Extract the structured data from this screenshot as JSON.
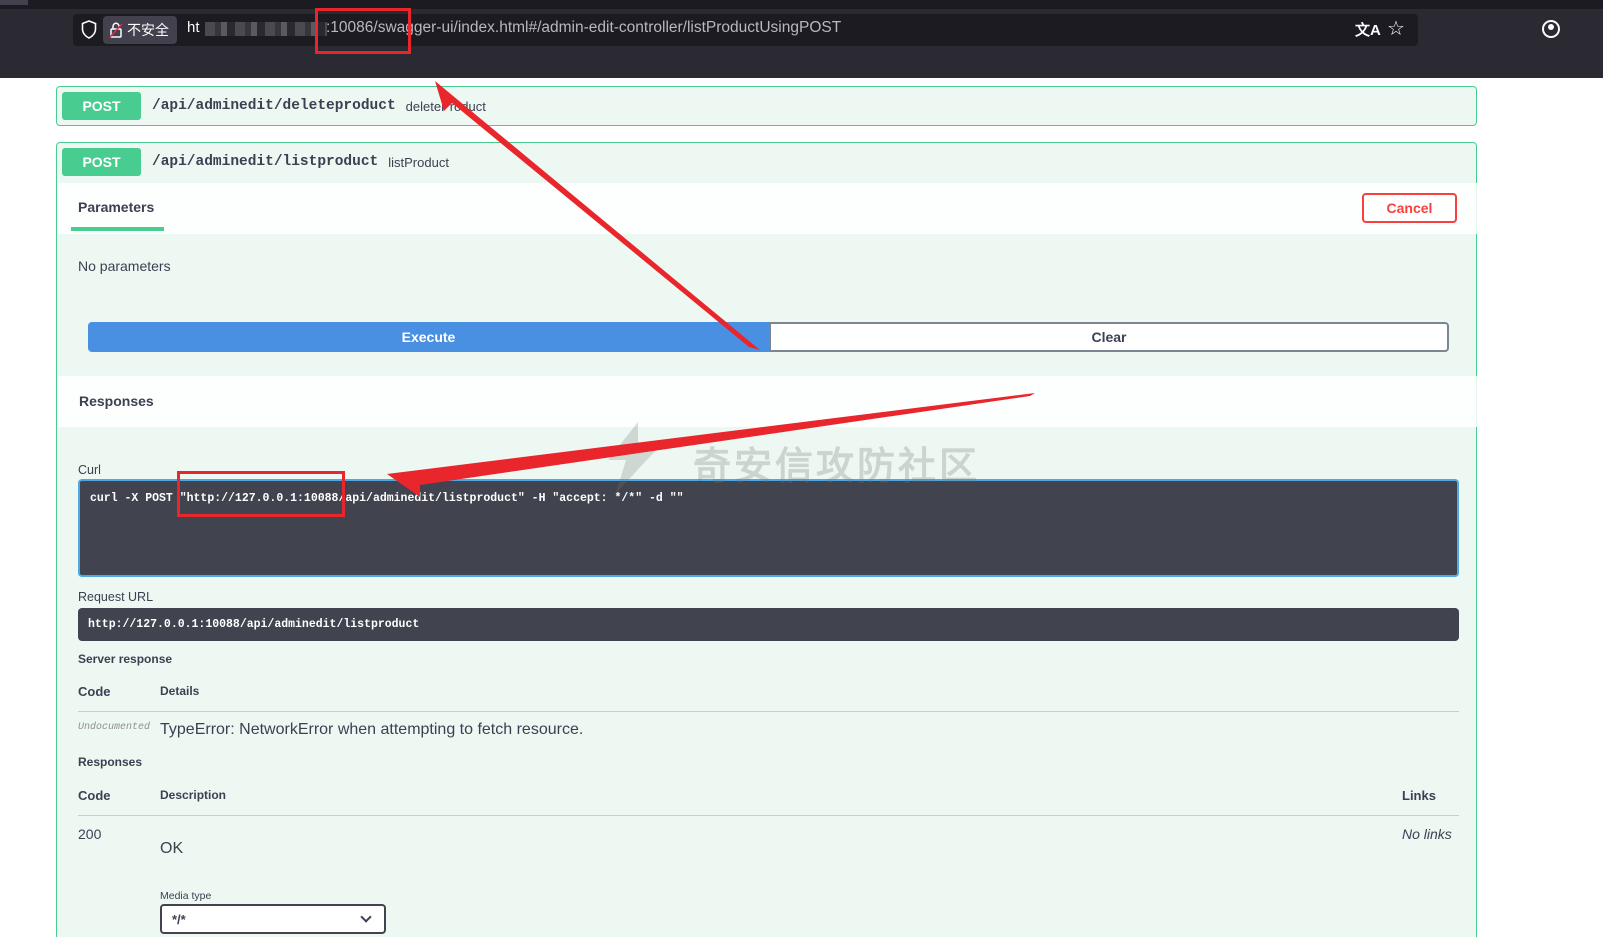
{
  "browser": {
    "insecure_label": "不安全",
    "url_prefix": "ht",
    "url_visible": ":10086/swagger-ui/index.html#/admin-edit-controller/listProductUsingPOST",
    "translate_icon": "translate-icon",
    "star_icon": "star-icon",
    "account_icon": "account-icon"
  },
  "operations": [
    {
      "method": "POST",
      "path": "/api/adminedit/deleteproduct",
      "summary": "deleteProduct"
    },
    {
      "method": "POST",
      "path": "/api/adminedit/listproduct",
      "summary": "listProduct"
    }
  ],
  "try_panel": {
    "tab_parameters": "Parameters",
    "cancel": "Cancel",
    "no_parameters": "No parameters",
    "execute": "Execute",
    "clear": "Clear"
  },
  "responses": {
    "title": "Responses",
    "curl_label": "Curl",
    "curl": "curl -X POST \"http://127.0.0.1:10088/api/adminedit/listproduct\" -H  \"accept: */*\" -d \"\"",
    "request_url_label": "Request URL",
    "request_url": "http://127.0.0.1:10088/api/adminedit/listproduct",
    "server_response_label": "Server response",
    "code_header": "Code",
    "details_header": "Details",
    "undocumented": "Undocumented",
    "error_text": "TypeError: NetworkError when attempting to fetch resource.",
    "responses_label": "Responses",
    "description_header": "Description",
    "links_header": "Links",
    "row_code": "200",
    "row_description": "OK",
    "row_links": "No links",
    "media_type_label": "Media type",
    "media_type_value": "*/*"
  },
  "watermark": "奇安信攻防社区",
  "colors": {
    "post_green": "#49cc90",
    "execute_blue": "#4990e2",
    "cancel_red": "#f93e3e",
    "annotation_red": "#e8262b"
  }
}
